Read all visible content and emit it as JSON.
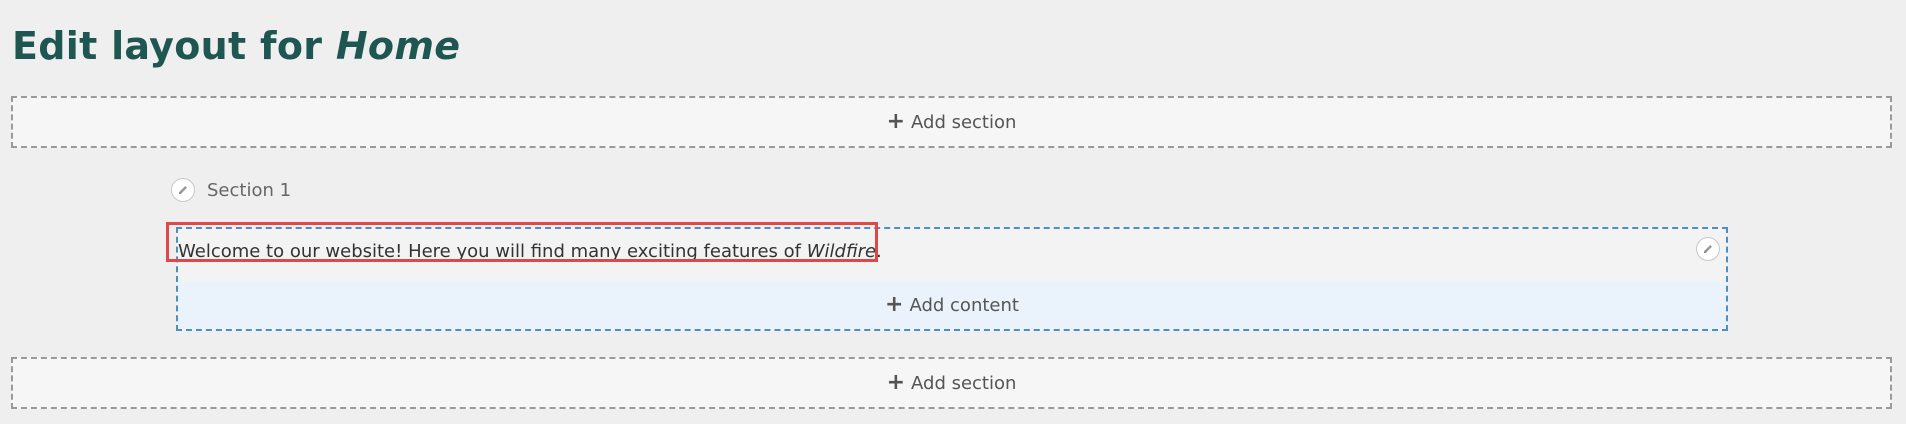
{
  "page": {
    "title_prefix": "Edit layout for",
    "title_entity": "Home"
  },
  "add_section_top": {
    "icon": "plus-icon",
    "label": "Add section"
  },
  "section": {
    "label": "Section 1",
    "edit_icon": "pencil-icon"
  },
  "block": {
    "text_prefix": "Welcome to our website! Here you will find many exciting features of ",
    "text_emphasis": "Wildfire",
    "text_suffix": ".",
    "edit_icon": "pencil-icon",
    "highlight_color": "#e04848"
  },
  "add_content": {
    "icon": "plus-icon",
    "label": "Add content"
  },
  "add_section_bottom": {
    "icon": "plus-icon",
    "label": "Add section"
  },
  "colors": {
    "title": "#1e5652",
    "region_border": "#4f8fc0",
    "add_content_bg": "#eaf3fb"
  }
}
